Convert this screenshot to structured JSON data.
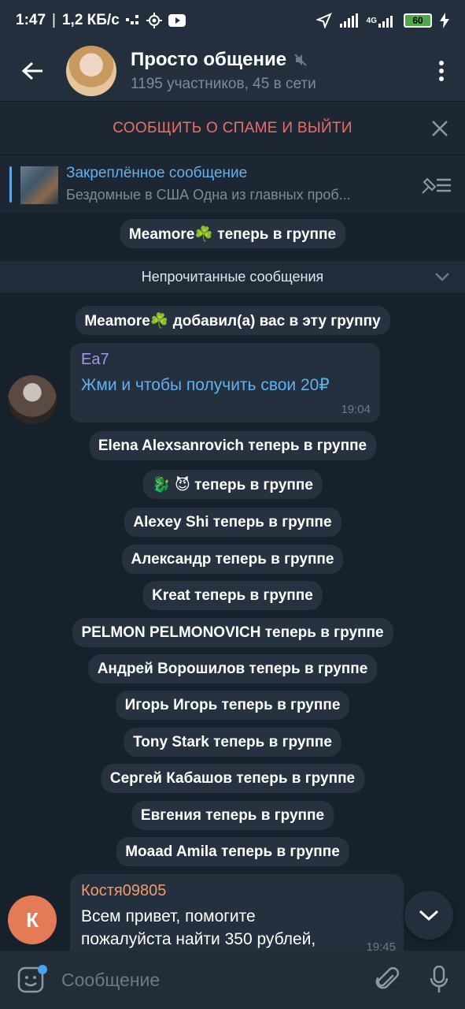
{
  "status_bar": {
    "time": "1:47",
    "separator": "|",
    "speed": "1,2 КБ/с",
    "network_label": "4G",
    "battery": "60"
  },
  "header": {
    "title": "Просто общение",
    "subtitle": "1195 участников, 45 в сети"
  },
  "spam_bar": {
    "label": "СООБЩИТЬ О СПАМЕ И ВЫЙТИ"
  },
  "pinned": {
    "title": "Закреплённое сообщение",
    "text": "Бездомные в США  Одна из главных проб..."
  },
  "service_top": "Meamore☘️ теперь в группе",
  "unread_label": "Непрочитанные сообщения",
  "service_added": "Meamore☘️ добавил(а) вас в эту группу",
  "message1": {
    "author": "Ea7",
    "author_color": "#a695e7",
    "text": "Жми и чтобы получить свои 20₽",
    "time": "19:04"
  },
  "joined": [
    "Elena Alexsanrovich теперь в группе",
    "🐉 😈 теперь в группе",
    "Alexey Shi теперь в группе",
    "Александр теперь в группе",
    "Kreat теперь в группе",
    "PELMON PELMONOVICH теперь в группе",
    "Андрей Ворошилов теперь в группе",
    "Игорь Игорь теперь в группе",
    "Tony Stark теперь в группе",
    "Сергей Кабашов теперь в группе",
    "Евгения теперь в группе",
    "Moaad Amila теперь в группе"
  ],
  "message2": {
    "author": "Костя09805",
    "author_color": "#f39a6b",
    "avatar_letter": "К",
    "avatar_color": "#e27b56",
    "text_line1": "Всем привет, помогите",
    "text_line2": "пожалуйста найти 350 рублей,",
    "time": "19:45"
  },
  "composer": {
    "placeholder": "Сообщение"
  },
  "colors": {
    "background": "#17212b",
    "header": "#232f3d",
    "accent": "#62b1ef",
    "spam": "#ec6e66"
  }
}
